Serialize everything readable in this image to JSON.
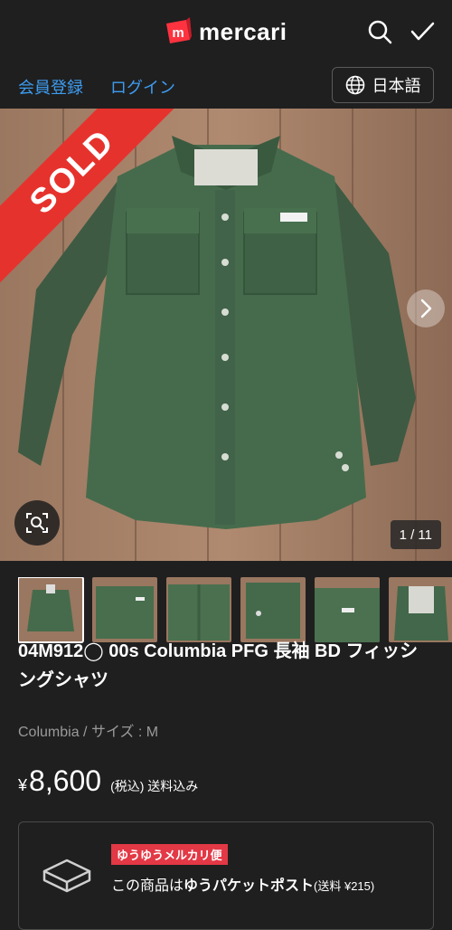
{
  "header": {
    "logo_text": "mercari",
    "logo_mark": "m",
    "search_icon": "search-icon",
    "check_icon": "check-icon"
  },
  "subbar": {
    "register": "会員登録",
    "login": "ログイン",
    "language": "日本語"
  },
  "gallery": {
    "sold_label": "SOLD",
    "counter": "1 / 11",
    "thumbnail_count": 6,
    "active_thumbnail": 1
  },
  "item": {
    "title": "04M912◯ 00s Columbia PFG 長袖 BD フィッシングシャツ",
    "brand": "Columbia",
    "brand_sep": " / ",
    "size": "サイズ : M",
    "currency": "¥",
    "price": "8,600",
    "tax_note": "(税込) 送料込み"
  },
  "shipping": {
    "badge": "ゆうゆうメルカリ便",
    "prefix": "この商品は",
    "method": "ゆうパケットポスト",
    "fee": "(送料 ¥215)"
  },
  "colors": {
    "accent_blue": "#3d9cf0",
    "sold_red": "#e6322d",
    "badge_red": "#e33845",
    "background": "#1f1f1f"
  }
}
